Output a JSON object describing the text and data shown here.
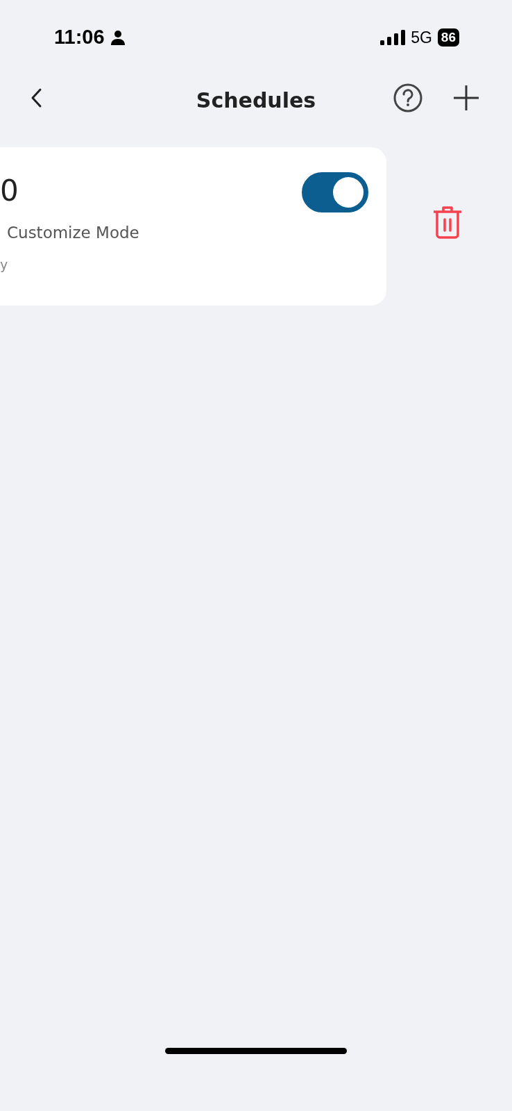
{
  "status_bar": {
    "time": "11:06",
    "network": "5G",
    "battery": "86"
  },
  "header": {
    "title": "Schedules"
  },
  "schedules": [
    {
      "time": "0",
      "mode": "Customize Mode",
      "repeat": "y",
      "on": true
    }
  ]
}
